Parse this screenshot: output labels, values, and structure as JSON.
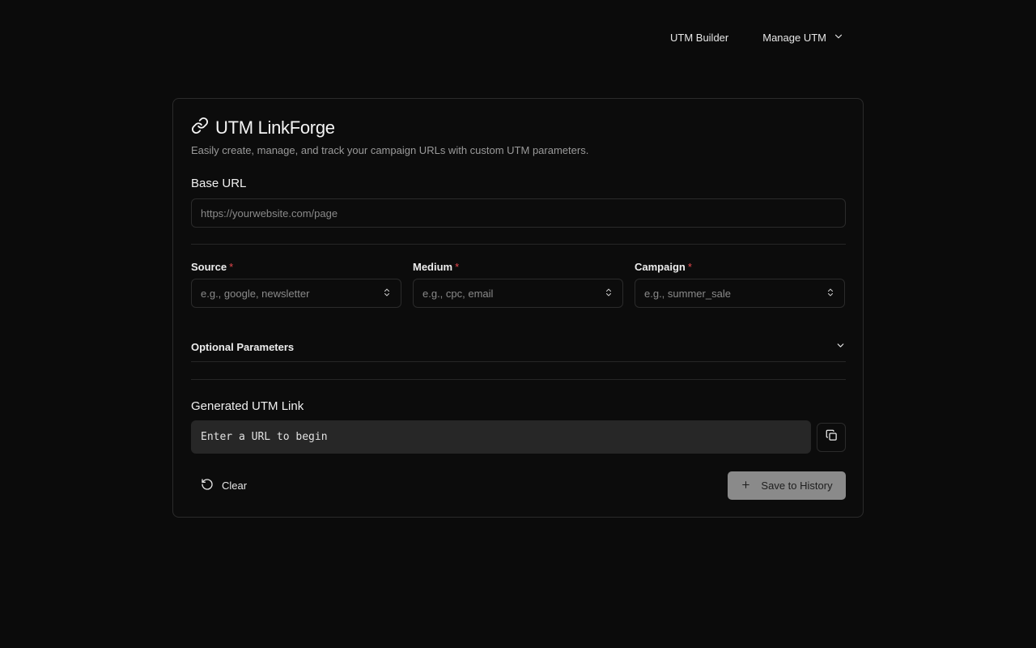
{
  "nav": {
    "builder_label": "UTM Builder",
    "manage_label": "Manage UTM"
  },
  "header": {
    "title": "UTM LinkForge",
    "subtitle": "Easily create, manage, and track your campaign URLs with custom UTM parameters."
  },
  "base_url": {
    "label": "Base URL",
    "placeholder": "https://yourwebsite.com/page",
    "value": ""
  },
  "fields": {
    "source": {
      "label": "Source",
      "required_mark": "*",
      "placeholder": "e.g., google, newsletter"
    },
    "medium": {
      "label": "Medium",
      "required_mark": "*",
      "placeholder": "e.g., cpc, email"
    },
    "campaign": {
      "label": "Campaign",
      "required_mark": "*",
      "placeholder": "e.g., summer_sale"
    }
  },
  "optional": {
    "label": "Optional Parameters"
  },
  "generated": {
    "label": "Generated UTM Link",
    "value": "Enter a URL to begin"
  },
  "actions": {
    "clear_label": "Clear",
    "save_label": "Save to History"
  },
  "icons": {
    "title": "link-icon",
    "manage": "chevron-down-icon",
    "select": "chevrons-up-down-icon",
    "optional": "chevron-down-icon",
    "copy": "copy-icon",
    "clear": "rotate-ccw-icon",
    "save": "plus-icon"
  },
  "colors": {
    "background": "#0b0b0b",
    "required": "#e5484d",
    "save_button": "#8a8a8a",
    "link_box": "#272727"
  }
}
